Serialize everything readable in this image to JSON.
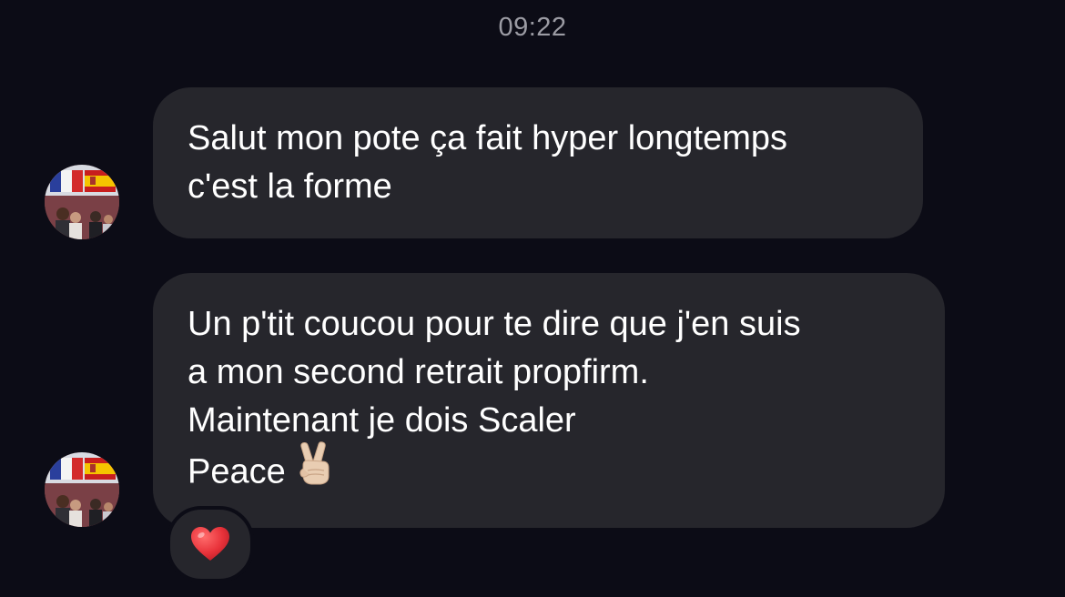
{
  "conversation": {
    "timestamp": "09:22",
    "messages": [
      {
        "lines": [
          "Salut mon pote ça fait hyper longtemps",
          "c'est la forme"
        ]
      },
      {
        "lines": [
          "Un p'tit coucou pour te dire que j'en suis",
          "a mon second retrait propfirm.",
          "Maintenant je dois Scaler",
          "Peace"
        ],
        "emoji": "victory-hand-icon",
        "reaction": "red-heart-icon"
      }
    ]
  },
  "colors": {
    "background": "#0c0c16",
    "bubble": "#26262c",
    "text": "#ffffff",
    "timestamp": "#9c9ca4",
    "heart": "#e8323a"
  }
}
